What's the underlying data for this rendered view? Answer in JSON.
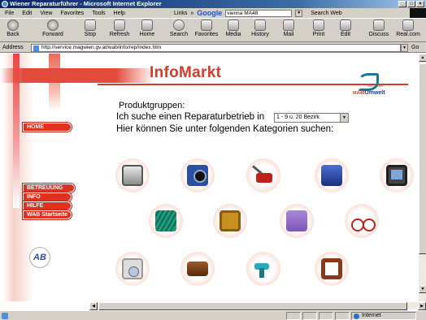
{
  "window": {
    "title": "Wiener Reparaturführer - Microsoft Internet Explorer",
    "controls": [
      "_",
      "□",
      "×"
    ]
  },
  "menubar": {
    "items": [
      "File",
      "Edit",
      "View",
      "Favorites",
      "Tools",
      "Help"
    ],
    "links_label": "Links",
    "chevron": "»",
    "google_logo": "Google",
    "google_query": "vienna MA48",
    "search_web_label": "Search Web"
  },
  "toolbar": {
    "buttons": [
      "Back",
      "Forward",
      "Stop",
      "Refresh",
      "Home",
      "Search",
      "Favorites",
      "Media",
      "History",
      "Mail",
      "Print",
      "Edit",
      "Discuss",
      "Real.com"
    ]
  },
  "addressbar": {
    "label": "Address",
    "url": "http://service.magwien.gv.at/wab/info/rep/index.htm",
    "go_label": "Go"
  },
  "page": {
    "brand_title": "InfoMarkt",
    "logo_text_prefix": "MA48",
    "logo_text_main": "Umwelt",
    "logo_small_text": "Wien schafft",
    "partial_line": "Produktgruppen:",
    "line1": "Ich suche einen Reparaturbetrieb in",
    "bezirk_select_value": "1 - 9 u. 20 Bezirk",
    "line2": "Hier können Sie unter folgenden Kategorien suchen:",
    "nav": {
      "home": "HOME",
      "betreuung": "BETREUUNG",
      "info": "INFO",
      "hilfe": "HILFE",
      "wab_startseite": "WAB Startseite"
    },
    "ab_logo": "AB",
    "categories": [
      {
        "icon": "computer-icon",
        "color": "#8d8d8d"
      },
      {
        "icon": "camera-icon",
        "color": "#2a4fa0"
      },
      {
        "icon": "lawn-mower-icon",
        "color": "#c0201a"
      },
      {
        "icon": "ski-boot-icon",
        "color": "#1a2f80"
      },
      {
        "icon": "television-icon",
        "color": "#444444"
      },
      {
        "icon": "garden-hose-icon",
        "color": "#1f9c7f"
      },
      {
        "icon": "watch-icon",
        "color": "#c89020"
      },
      {
        "icon": "armchair-icon",
        "color": "#7a56b8"
      },
      {
        "icon": "bicycle-icon",
        "color": "#c0201a"
      },
      {
        "icon": "washing-machine-icon",
        "color": "#999999"
      },
      {
        "icon": "shoe-icon",
        "color": "#5a2a0a"
      },
      {
        "icon": "power-drill-icon",
        "color": "#2aa8b8"
      },
      {
        "icon": "belt-icon",
        "color": "#8a3a1a"
      }
    ]
  },
  "statusbar": {
    "zone": "Internet"
  },
  "colors": {
    "accent_red": "#d73a2a",
    "nav_red": "#e0301e",
    "chrome_gray": "#d4d0c8",
    "titlebar_blue": "#0a246a"
  }
}
